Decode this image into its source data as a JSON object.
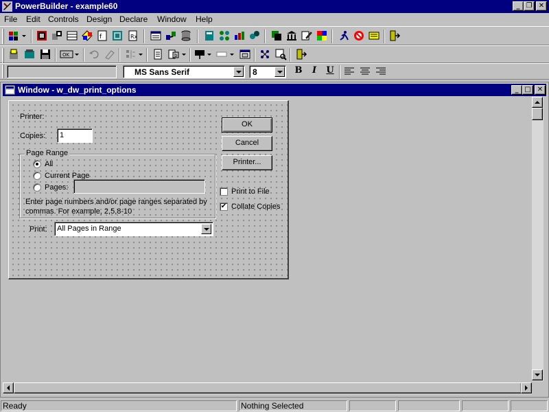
{
  "app": {
    "title": "PowerBuilder - example60",
    "controls": {
      "minimize": "_",
      "restore": "❐",
      "close": "✕"
    }
  },
  "menu": [
    {
      "label": "File",
      "accel": "F"
    },
    {
      "label": "Edit",
      "accel": "E"
    },
    {
      "label": "Controls",
      "accel": "C"
    },
    {
      "label": "Design",
      "accel": "D"
    },
    {
      "label": "Declare",
      "accel": "l"
    },
    {
      "label": "Window",
      "accel": "W"
    },
    {
      "label": "Help",
      "accel": "H"
    }
  ],
  "stylebar": {
    "control_name": "",
    "font": "MS Sans Serif",
    "size": "8",
    "bold": "B",
    "italic": "I",
    "underline": "U"
  },
  "child_window": {
    "title": "Window - w_dw_print_options"
  },
  "dialog": {
    "printer_label": "Printer:",
    "copies_label": "Copies:",
    "copies_value": "1",
    "ok": "OK",
    "cancel": "Cancel",
    "printer_button": "Printer...",
    "page_range": {
      "label": "Page Range",
      "all": "All",
      "current_page": "Current Page",
      "pages": "Pages:",
      "pages_value": "",
      "selected": "all"
    },
    "help_text_line1": "Enter page numbers and/or page ranges separated by",
    "help_text_line2": "commas. For example, 2,5,8-10",
    "print_to_file": {
      "label": "Print to File",
      "checked": false
    },
    "collate_copies": {
      "label": "Collate Copies",
      "checked": true,
      "mark": "✔"
    },
    "print_label": "Print:",
    "print_value": "All Pages in Range"
  },
  "status": {
    "left": "Ready",
    "middle": "Nothing Selected"
  },
  "colors": {
    "titlebar": "#000080",
    "face": "#c0c0c0"
  }
}
